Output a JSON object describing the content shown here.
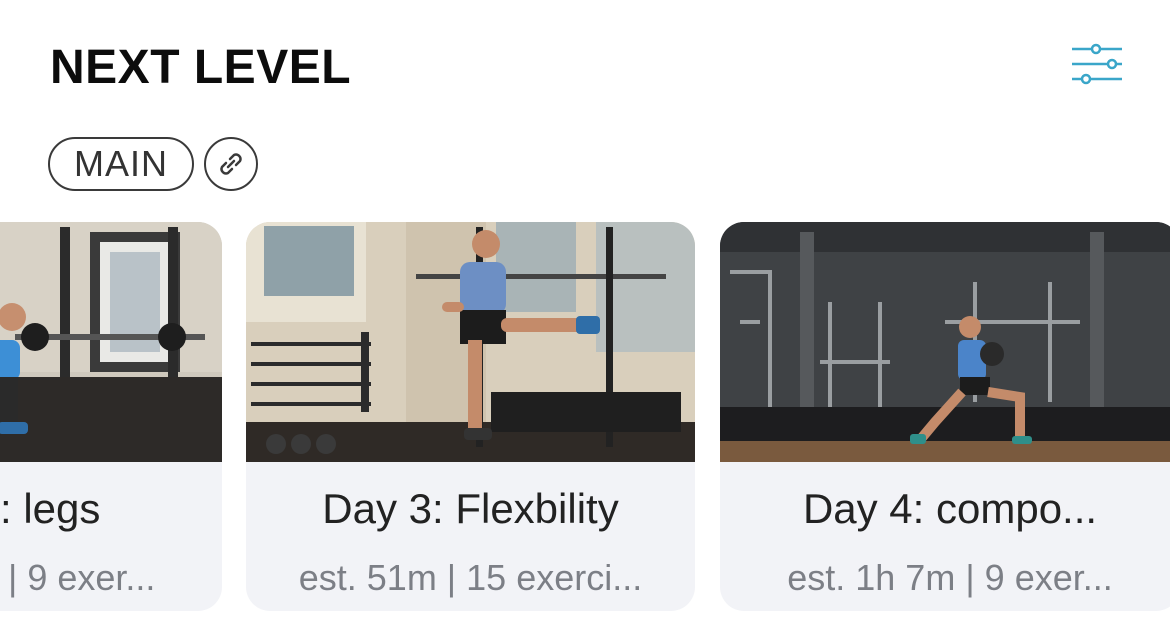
{
  "header": {
    "title": "NEXT LEVEL",
    "filter_icon": "sliders-icon"
  },
  "tags": {
    "main_label": "MAIN",
    "link_icon": "link-icon"
  },
  "colors": {
    "accent": "#3aa6c9",
    "card_bg": "#f2f3f7",
    "meta_text": "#7c7f86"
  },
  "workouts": [
    {
      "name": ": legs",
      "meta": "| 9 exer..."
    },
    {
      "name": "Day 3: Flexbility",
      "meta": "est. 51m | 15 exerci..."
    },
    {
      "name": "Day 4: compo...",
      "meta": "est. 1h 7m | 9 exer..."
    }
  ]
}
